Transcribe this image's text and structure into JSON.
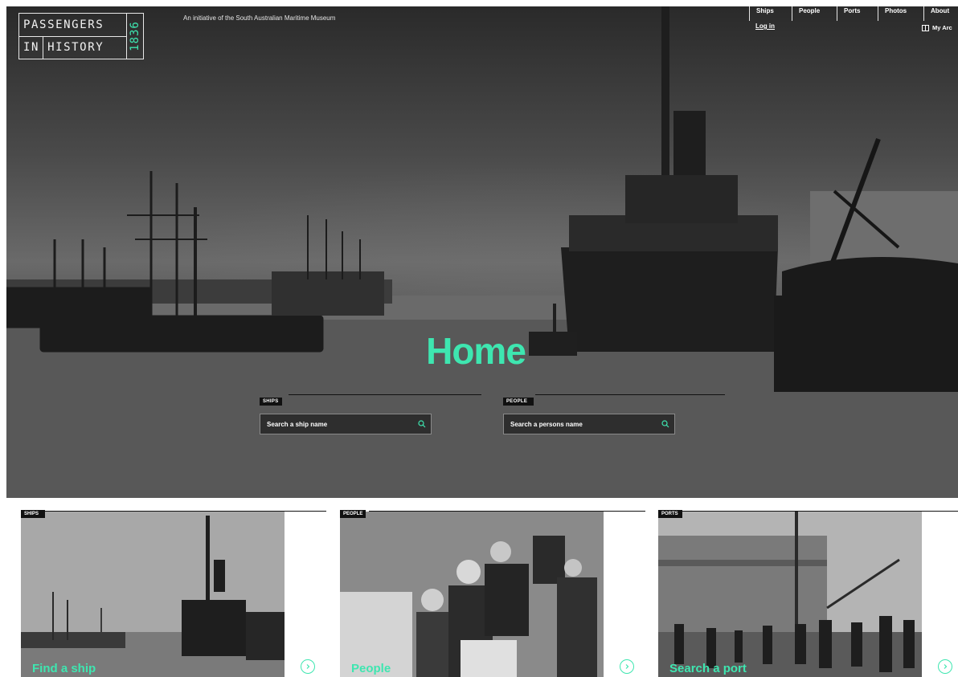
{
  "brand": {
    "logo_line1": "PASSENGERS",
    "logo_line2_a": "IN",
    "logo_line2_b": "HISTORY",
    "logo_year": "1836",
    "tagline": "An initiative of the South Australian Maritime Museum"
  },
  "nav": {
    "items": [
      "Ships",
      "People",
      "Ports",
      "Photos",
      "About"
    ],
    "login": "Log in",
    "archive": "My Arc"
  },
  "hero": {
    "title": "Home",
    "search_ships": {
      "tag": "SHIPS",
      "placeholder": "Search a ship name"
    },
    "search_people": {
      "tag": "PEOPLE",
      "placeholder": "Search a persons name"
    }
  },
  "cards": [
    {
      "tag": "SHIPS",
      "label": "Find a ship"
    },
    {
      "tag": "PEOPLE",
      "label": "People"
    },
    {
      "tag": "PORTS",
      "label": "Search a port"
    }
  ],
  "colors": {
    "accent": "#3ee6b0",
    "dark": "#111111",
    "hero_bg": "#4a4a4a"
  },
  "icons": [
    "search-icon",
    "book-icon",
    "chevron-right-icon"
  ]
}
